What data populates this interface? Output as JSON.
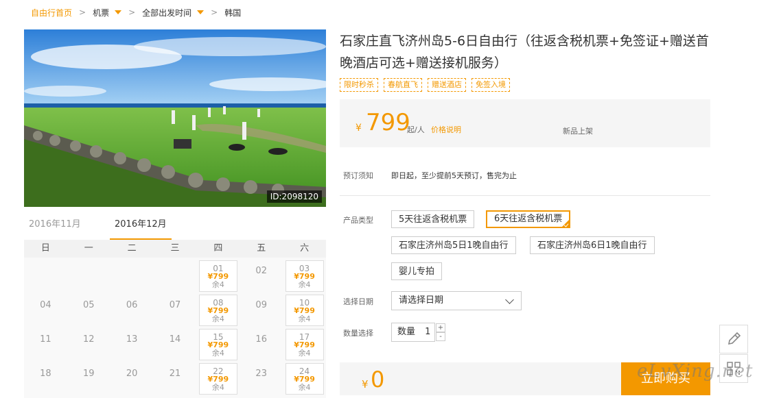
{
  "breadcrumb": {
    "home": "自由行首页",
    "items": [
      "机票",
      "全部出发时间",
      "韩国"
    ]
  },
  "photo": {
    "id_label": "ID:2098120"
  },
  "calendar": {
    "tabs": [
      "2016年11月",
      "2016年12月"
    ],
    "active_tab": 1,
    "weekdays": [
      "日",
      "一",
      "二",
      "三",
      "四",
      "五",
      "六"
    ],
    "weeks": [
      [
        null,
        null,
        null,
        null,
        {
          "d": "01",
          "price": "¥799",
          "rest": "余4"
        },
        {
          "d": "02"
        },
        {
          "d": "03",
          "price": "¥799",
          "rest": "余4"
        }
      ],
      [
        {
          "d": "04"
        },
        {
          "d": "05"
        },
        {
          "d": "06"
        },
        {
          "d": "07"
        },
        {
          "d": "08",
          "price": "¥799",
          "rest": "余4"
        },
        {
          "d": "09"
        },
        {
          "d": "10",
          "price": "¥799",
          "rest": "余4"
        }
      ],
      [
        {
          "d": "11"
        },
        {
          "d": "12"
        },
        {
          "d": "13"
        },
        {
          "d": "14"
        },
        {
          "d": "15",
          "price": "¥799",
          "rest": "余4"
        },
        {
          "d": "16"
        },
        {
          "d": "17",
          "price": "¥799",
          "rest": "余4"
        }
      ],
      [
        {
          "d": "18"
        },
        {
          "d": "19"
        },
        {
          "d": "20"
        },
        {
          "d": "21"
        },
        {
          "d": "22",
          "price": "¥799",
          "rest": "余4"
        },
        {
          "d": "23"
        },
        {
          "d": "24",
          "price": "¥799",
          "rest": "余4"
        }
      ]
    ]
  },
  "product": {
    "title": "石家庄直飞济州岛5-6日自由行（往返含税机票+免签证+赠送首晚酒店可选+赠送接机服务）",
    "tags": [
      "限时秒杀",
      "春航直飞",
      "赠送酒店",
      "免签入境"
    ],
    "price": {
      "currency": "¥",
      "value": "799",
      "unit": "起/人",
      "explain_link": "价格说明",
      "new_label": "新品上架"
    },
    "booking_notice_label": "预订须知",
    "booking_notice": "即日起，至少提前5天预订，售完为止",
    "type_label": "产品类型",
    "types": [
      "5天往返含税机票",
      "6天往返含税机票",
      "石家庄济州岛5日1晚自由行",
      "石家庄济州岛6日1晚自由行",
      "婴儿专拍"
    ],
    "selected_type": 1,
    "date_label": "选择日期",
    "date_placeholder": "请选择日期",
    "qty_label": "数量选择",
    "qty_text": "数量",
    "qty_value": "1",
    "qty_plus": "+",
    "qty_minus": "-",
    "total_currency": "¥",
    "total": "0",
    "buy_label": "立即购买"
  },
  "watermark": "eLvXing.net",
  "colors": {
    "accent": "#f39800"
  }
}
